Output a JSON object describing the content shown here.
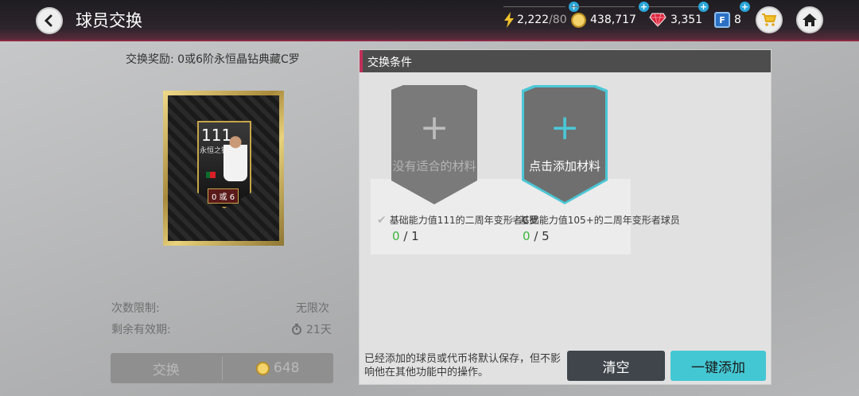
{
  "header": {
    "title": "球员交换",
    "energy": {
      "value": "2,222",
      "max": "/80"
    },
    "coins": "438,717",
    "gems": "3,351",
    "tokens": "8"
  },
  "left": {
    "reward_label": "交换奖励:",
    "reward_value": "0或6阶永恒晶钻典藏C罗",
    "card": {
      "rating": "111",
      "position": "永恒之钻",
      "tier_text": "0 或 6"
    },
    "limit_label": "次数限制:",
    "limit_value": "无限次",
    "expire_label": "剩余有效期:",
    "expire_value": "21天",
    "exchange_label": "交换",
    "exchange_cost": "648"
  },
  "panel": {
    "title": "交换条件",
    "slots": [
      {
        "label": "没有适合的材料",
        "condition": "基础能力值111的二周年变形者C罗",
        "have": "0",
        "need": "/ 1"
      },
      {
        "label": "点击添加材料",
        "condition": "基础能力值105+的二周年变形者球员",
        "have": "0",
        "need": "/ 5"
      }
    ],
    "note": "已经添加的球员或代币将默认保存，但不影响他在其他功能中的操作。",
    "clear_label": "清空",
    "add_all_label": "一键添加"
  },
  "colors": {
    "accent": "#c0305a",
    "teal": "#43c7d3",
    "green": "#3db53d"
  },
  "icons": [
    "back-icon",
    "lightning-icon",
    "coin-icon",
    "gem-icon",
    "token-icon",
    "cart-icon",
    "home-icon",
    "timer-icon",
    "check-icon"
  ]
}
